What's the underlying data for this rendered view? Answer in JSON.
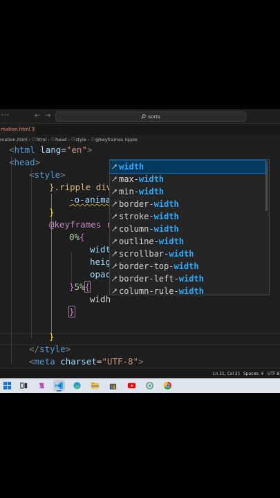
{
  "titlebar": {
    "menu_dots": "···",
    "back_arrow": "←",
    "forward_arrow": "→",
    "search_text": "sorts",
    "search_icon": "search-icon"
  },
  "tab": {
    "filename": "mation.html",
    "problem_count": "3",
    "modified": true
  },
  "breadcrumb": {
    "items": [
      "mation.html",
      "html",
      "head",
      "style",
      "@keyframes ripple"
    ],
    "icons": [
      "html-file-icon",
      "element-icon",
      "element-icon",
      "element-icon",
      "element-icon"
    ]
  },
  "editor": {
    "lines": [
      {
        "a": "<",
        "b": "html",
        "c": " lang",
        "d": "=",
        "e": "\"en\"",
        "f": ">"
      },
      {
        "a": "<",
        "b": "head",
        "f": ">"
      },
      {
        "a": "<",
        "b": "style",
        "f": ">"
      },
      {
        "sel": "}.ripple div"
      },
      {
        "prop": "-o-anima"
      },
      {
        "brace": "}"
      },
      {
        "kw": "@keyframes r"
      },
      {
        "num": "0%",
        "brace": "{"
      },
      {
        "prop": "widt"
      },
      {
        "prop": "heig"
      },
      {
        "prop": "opac"
      },
      {
        "brace_close": "}",
        "num": "5%",
        "brace": "{"
      },
      {
        "typed": "widh"
      },
      {
        "brace": "}"
      },
      {
        "brace": "}"
      },
      {
        "a": "</",
        "b": "style",
        "f": ">"
      },
      {
        "a": "<",
        "b": "meta",
        "c": " charset",
        "d": "=",
        "e": "\"UTF-8\"",
        "f": ">"
      }
    ]
  },
  "suggestions": {
    "icon": "wrench-icon",
    "items": [
      {
        "pre": "",
        "match": "width",
        "post": ""
      },
      {
        "pre": "max-",
        "match": "width",
        "post": ""
      },
      {
        "pre": "min-",
        "match": "width",
        "post": ""
      },
      {
        "pre": "border-",
        "match": "width",
        "post": ""
      },
      {
        "pre": "stroke-",
        "match": "width",
        "post": ""
      },
      {
        "pre": "column-",
        "match": "width",
        "post": ""
      },
      {
        "pre": "outline-",
        "match": "width",
        "post": ""
      },
      {
        "pre": "scrollbar-",
        "match": "width",
        "post": ""
      },
      {
        "pre": "border-top-",
        "match": "width",
        "post": ""
      },
      {
        "pre": "border-left-",
        "match": "width",
        "post": ""
      },
      {
        "pre": "column-rule-",
        "match": "width",
        "post": ""
      }
    ],
    "selected_index": 0
  },
  "statusbar": {
    "position": "Ln 31, Col 21",
    "spaces": "Spaces: 4",
    "encoding": "UTF-8"
  },
  "taskbar": {
    "icons": [
      "start-icon",
      "task-view-icon",
      "copilot-icon",
      "vscode-icon",
      "edge-icon",
      "file-explorer-icon",
      "store-icon",
      "youtube-icon",
      "chatgpt-icon",
      "chrome-icon"
    ],
    "active": "vscode-icon"
  },
  "colors": {
    "editor_bg": "#1e1e1e",
    "selection": "#04395e",
    "match_highlight": "#2aaaff",
    "tag": "#569cd6",
    "string": "#ce9178"
  }
}
